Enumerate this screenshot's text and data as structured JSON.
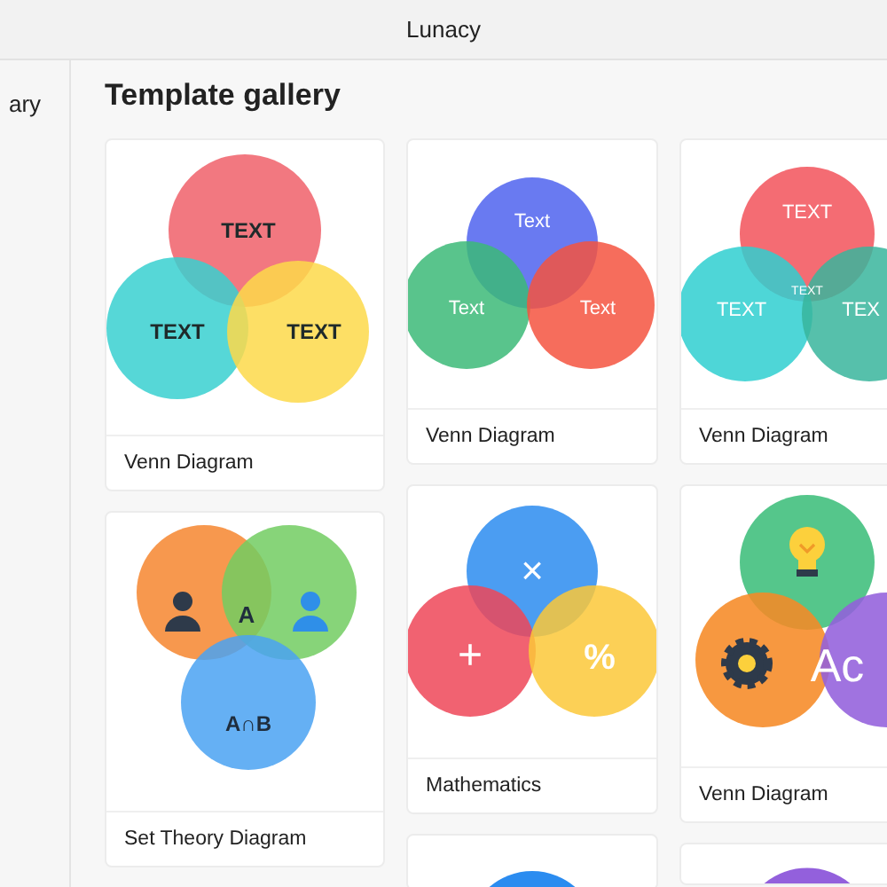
{
  "window": {
    "title": "Lunacy"
  },
  "sidebar": {
    "items": [
      {
        "label": "ary"
      }
    ]
  },
  "gallery": {
    "title": "Template gallery",
    "columns": [
      {
        "cards": [
          {
            "kind": "classic",
            "labels": [
              "TEXT",
              "TEXT",
              "TEXT"
            ],
            "caption": "Venn Diagram"
          },
          {
            "kind": "sets",
            "labels": [
              "A",
              "A∩B"
            ],
            "caption": "Set Theory Diagram"
          }
        ]
      },
      {
        "cards": [
          {
            "kind": "overlap",
            "labels": [
              "Text",
              "Text",
              "Text"
            ],
            "caption": "Venn Diagram"
          },
          {
            "kind": "math",
            "labels": [
              "×",
              "+",
              "%"
            ],
            "caption": "Mathematics"
          },
          {
            "kind": "bluepeek"
          }
        ]
      },
      {
        "cards": [
          {
            "kind": "layered",
            "labels": [
              "TEXT",
              "TEXT",
              "TEX",
              "TEXT"
            ],
            "caption": "Venn Diagram"
          },
          {
            "kind": "icons",
            "labels": [
              "Ac"
            ],
            "caption": "Venn Diagram"
          },
          {
            "kind": "purplepeek"
          }
        ]
      }
    ]
  }
}
